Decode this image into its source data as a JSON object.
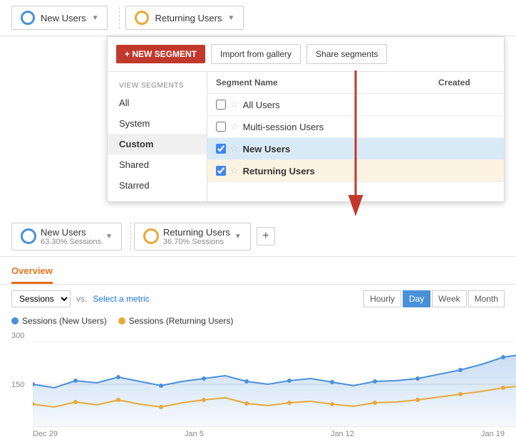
{
  "topPills": {
    "newUsers": {
      "label": "New Users",
      "iconType": "new"
    },
    "returningUsers": {
      "label": "Returning Users",
      "iconType": "returning"
    }
  },
  "dropdown": {
    "newSegmentButton": "+ NEW SEGMENT",
    "importButton": "Import from gallery",
    "shareButton": "Share segments",
    "sidebarLabel": "VIEW SEGMENTS",
    "sidebarItems": [
      {
        "id": "all",
        "label": "All",
        "active": false
      },
      {
        "id": "system",
        "label": "System",
        "active": false
      },
      {
        "id": "custom",
        "label": "Custom",
        "active": true
      },
      {
        "id": "shared",
        "label": "Shared",
        "active": false
      },
      {
        "id": "starred",
        "label": "Starred",
        "active": false
      }
    ],
    "tableHeaders": {
      "name": "Segment Name",
      "created": "Created"
    },
    "segments": [
      {
        "id": "all-users",
        "label": "All Users",
        "checked": false,
        "starred": false,
        "highlighted": "none"
      },
      {
        "id": "multi-session",
        "label": "Multi-session Users",
        "checked": false,
        "starred": false,
        "highlighted": "none"
      },
      {
        "id": "new-users",
        "label": "New Users",
        "checked": true,
        "starred": false,
        "highlighted": "blue",
        "bold": true
      },
      {
        "id": "returning-users",
        "label": "Returning Users",
        "checked": true,
        "starred": false,
        "highlighted": "orange",
        "bold": true
      }
    ]
  },
  "bottomPills": {
    "newUsers": {
      "label": "New Users",
      "sub": "63.30% Sessions"
    },
    "returningUsers": {
      "label": "Returning Users",
      "sub": "36.70% Sessions"
    },
    "addButton": "+"
  },
  "tabs": {
    "overview": "Overview"
  },
  "chartControls": {
    "sessionsLabel": "Sessions",
    "vsLabel": "vs.",
    "metricLabel": "Select a metric",
    "timeButtons": [
      "Hourly",
      "Day",
      "Week",
      "Month"
    ],
    "activeTimeButton": "Day"
  },
  "legend": [
    {
      "label": "Sessions (New Users)",
      "color": "#4a90d9"
    },
    {
      "label": "Sessions (Returning Users)",
      "color": "#e8a838"
    }
  ],
  "chart": {
    "yLabels": [
      "300",
      "150"
    ],
    "xLabels": [
      "Dec 29",
      "Jan 5",
      "Jan 12",
      "Jan 19"
    ],
    "newUsersData": [
      150,
      130,
      155,
      140,
      160,
      145,
      135,
      150,
      155,
      160,
      145,
      140,
      150,
      155,
      145,
      140,
      155,
      150,
      155,
      165,
      175,
      195,
      210
    ],
    "returningUsersData": [
      80,
      70,
      85,
      75,
      90,
      80,
      70,
      85,
      90,
      95,
      80,
      75,
      85,
      90,
      80,
      75,
      85,
      80,
      85,
      90,
      95,
      100,
      110
    ]
  },
  "arrow": {
    "visible": true
  }
}
